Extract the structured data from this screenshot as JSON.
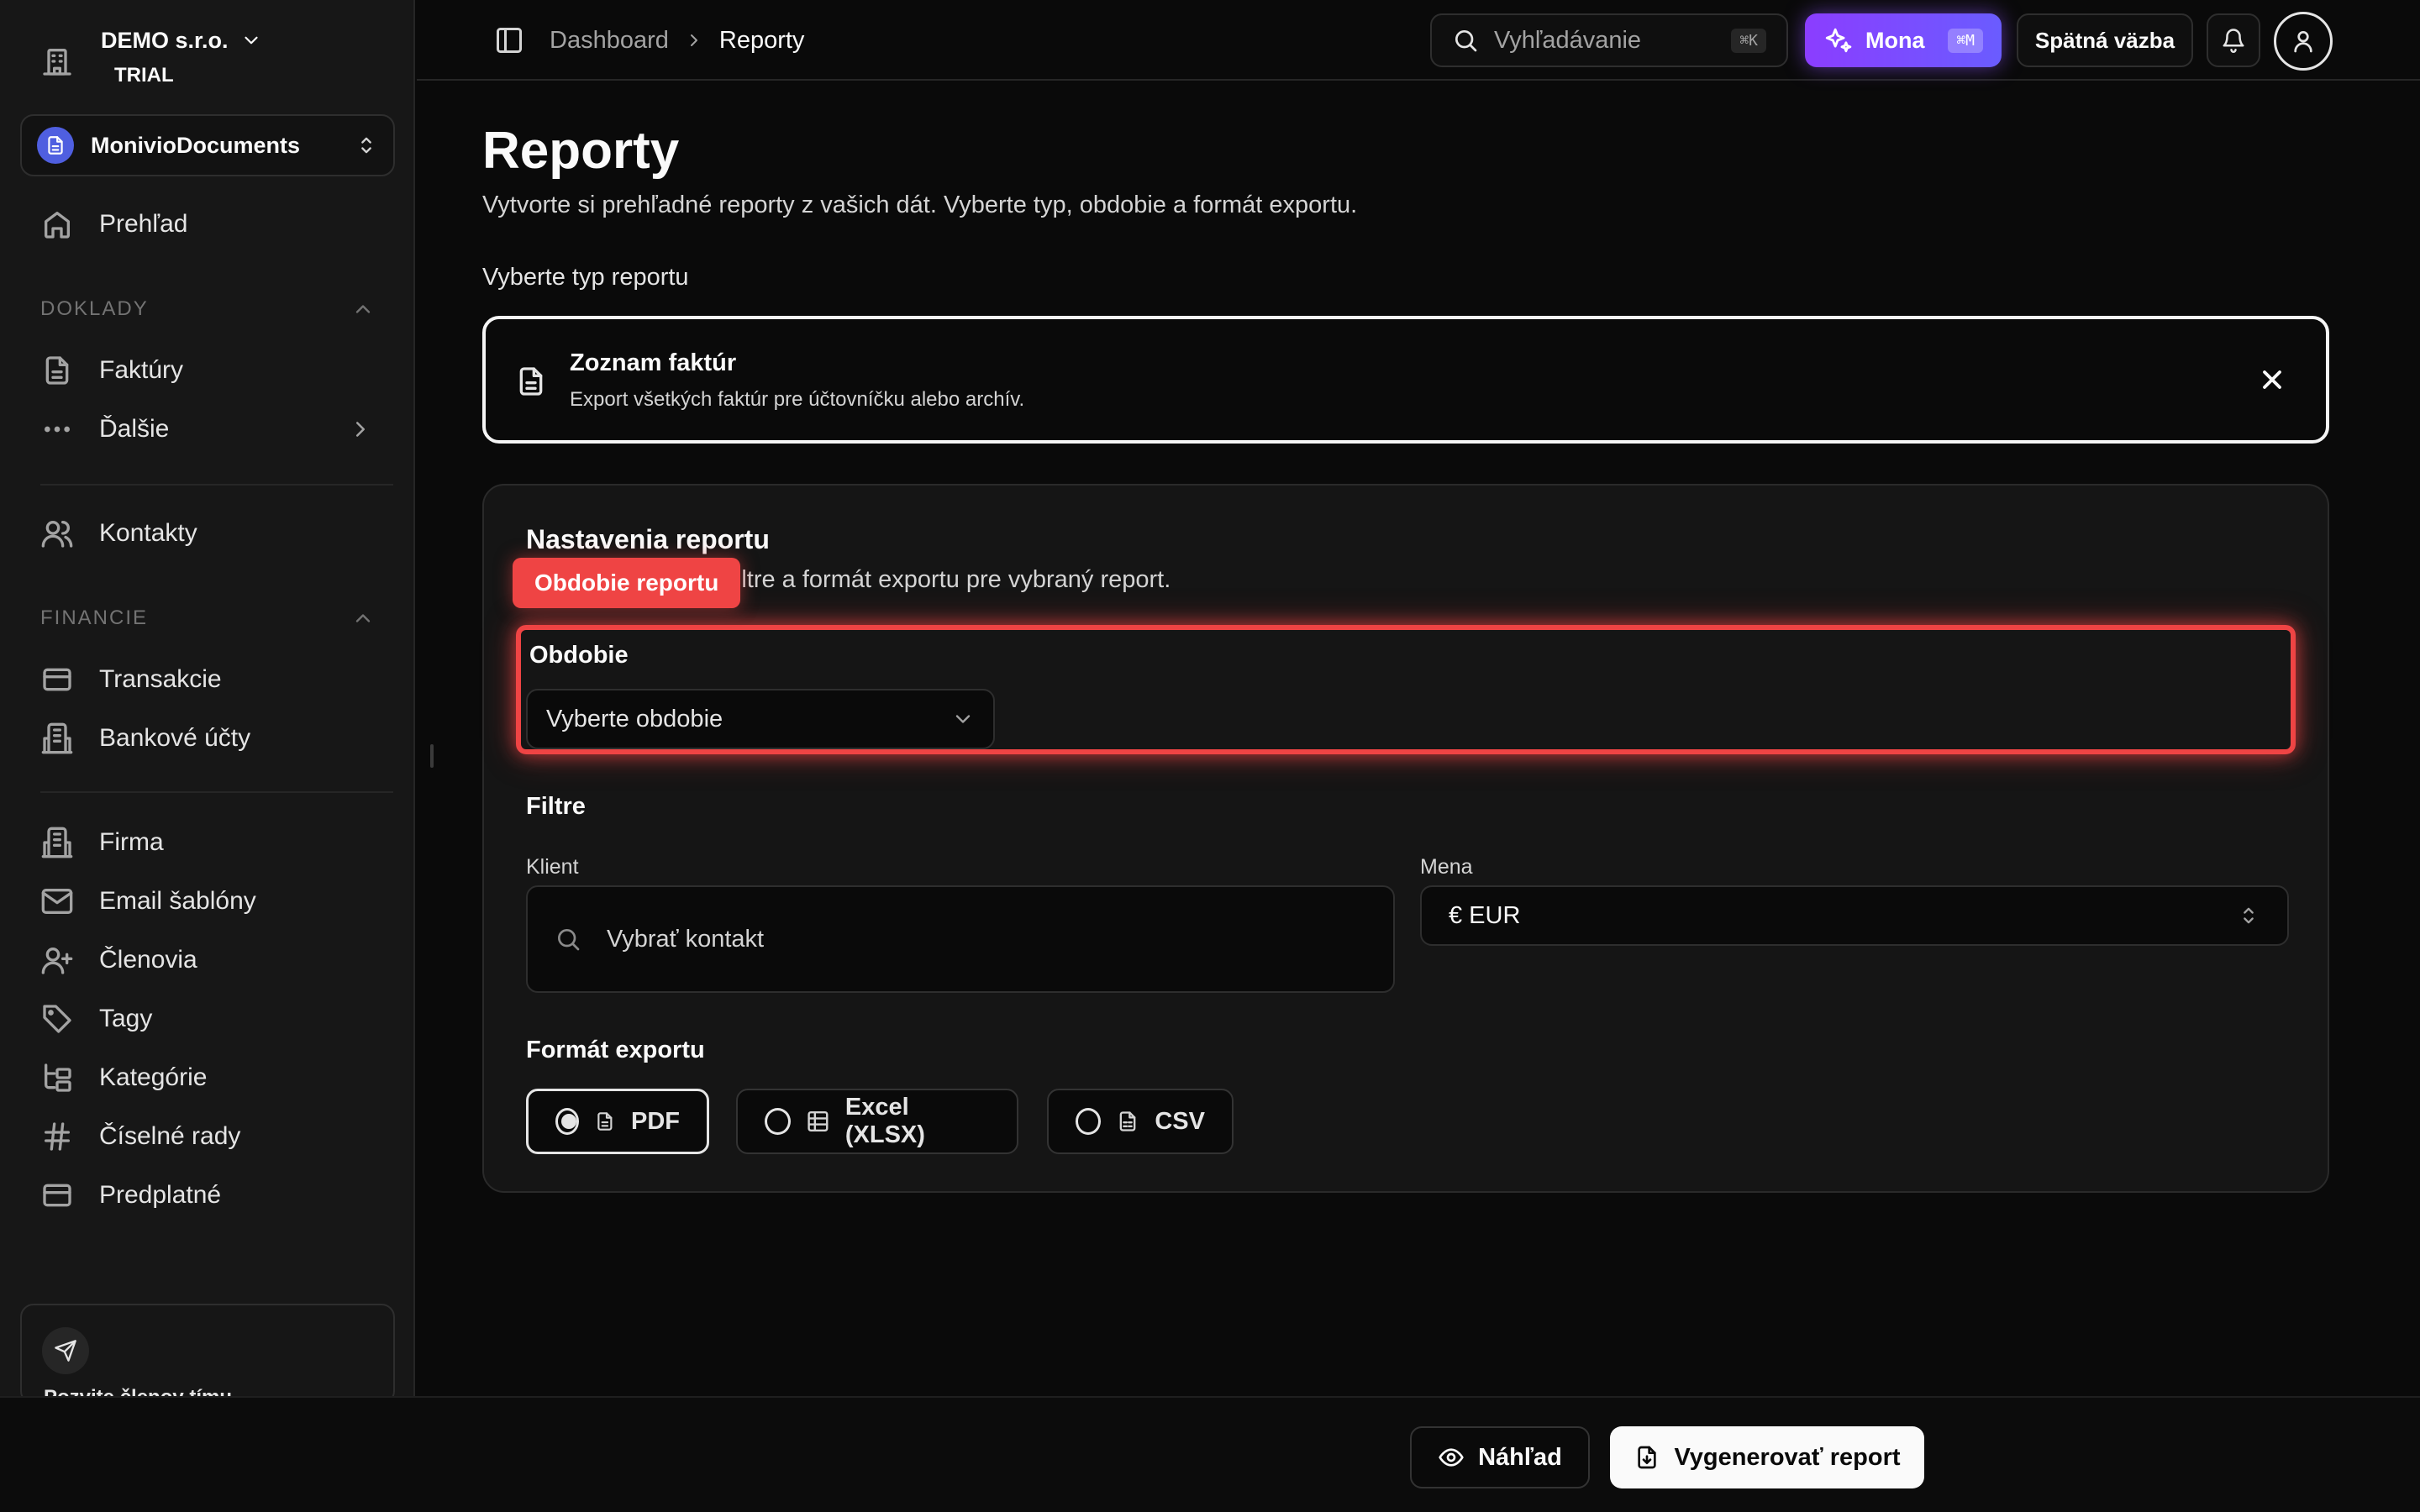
{
  "sidebar": {
    "org_name": "DEMO s.r.o.",
    "org_plan": "TRIAL",
    "workspace": "MonivioDocuments",
    "overview": "Prehľad",
    "section_documents": "DOKLADY",
    "invoices": "Faktúry",
    "more": "Ďalšie",
    "contacts": "Kontakty",
    "section_finance": "FINANCIE",
    "transactions": "Transakcie",
    "bank_accounts": "Bankové účty",
    "company": "Firma",
    "email_templates": "Email šablóny",
    "members": "Členovia",
    "tags": "Tagy",
    "categories": "Kategórie",
    "number_series": "Číselné rady",
    "subscription": "Predplatné",
    "promo_text": "Pozvite členov tímu"
  },
  "header": {
    "breadcrumb_1": "Dashboard",
    "breadcrumb_2": "Reporty",
    "search_placeholder": "Vyhľadávanie",
    "search_shortcut": "⌘K",
    "mona_label": "Mona",
    "mona_shortcut": "⌘M",
    "feedback_label": "Spätná väzba"
  },
  "main": {
    "title": "Reporty",
    "subtitle": "Vytvorte si prehľadné reporty z vašich dát. Vyberte typ, obdobie a formát exportu.",
    "type_label": "Vyberte typ reportu",
    "type_card": {
      "title": "Zoznam faktúr",
      "description": "Export všetkých faktúr pre účtovníčku alebo archív."
    },
    "settings": {
      "title": "Nastavenia reportu",
      "description": "Nastavte obdobie, filtre a formát exportu pre vybraný report.",
      "highlight_tag": "Obdobie reportu",
      "period_label": "Obdobie",
      "period_placeholder": "Vyberte obdobie",
      "filters_label": "Filtre",
      "client_label": "Klient",
      "client_placeholder": "Vybrať kontakt",
      "currency_label": "Mena",
      "currency_value": "€ EUR",
      "format_label": "Formát exportu",
      "formats": [
        "PDF",
        "Excel (XLSX)",
        "CSV"
      ],
      "selected_format": "PDF"
    }
  },
  "footer": {
    "preview_label": "Náhľad",
    "generate_label": "Vygenerovať report"
  },
  "colors": {
    "accent_purple": "#8b3dff",
    "highlight_red": "#ef4444",
    "background": "#0a0a0a"
  },
  "icons": {
    "org": "building-icon",
    "workspace": "document-icon",
    "search": "search-icon",
    "mona": "sparkles-icon",
    "notifications": "bell-icon",
    "user": "user-icon",
    "close": "close-icon",
    "preview": "eye-icon",
    "generate": "file-download-icon"
  }
}
